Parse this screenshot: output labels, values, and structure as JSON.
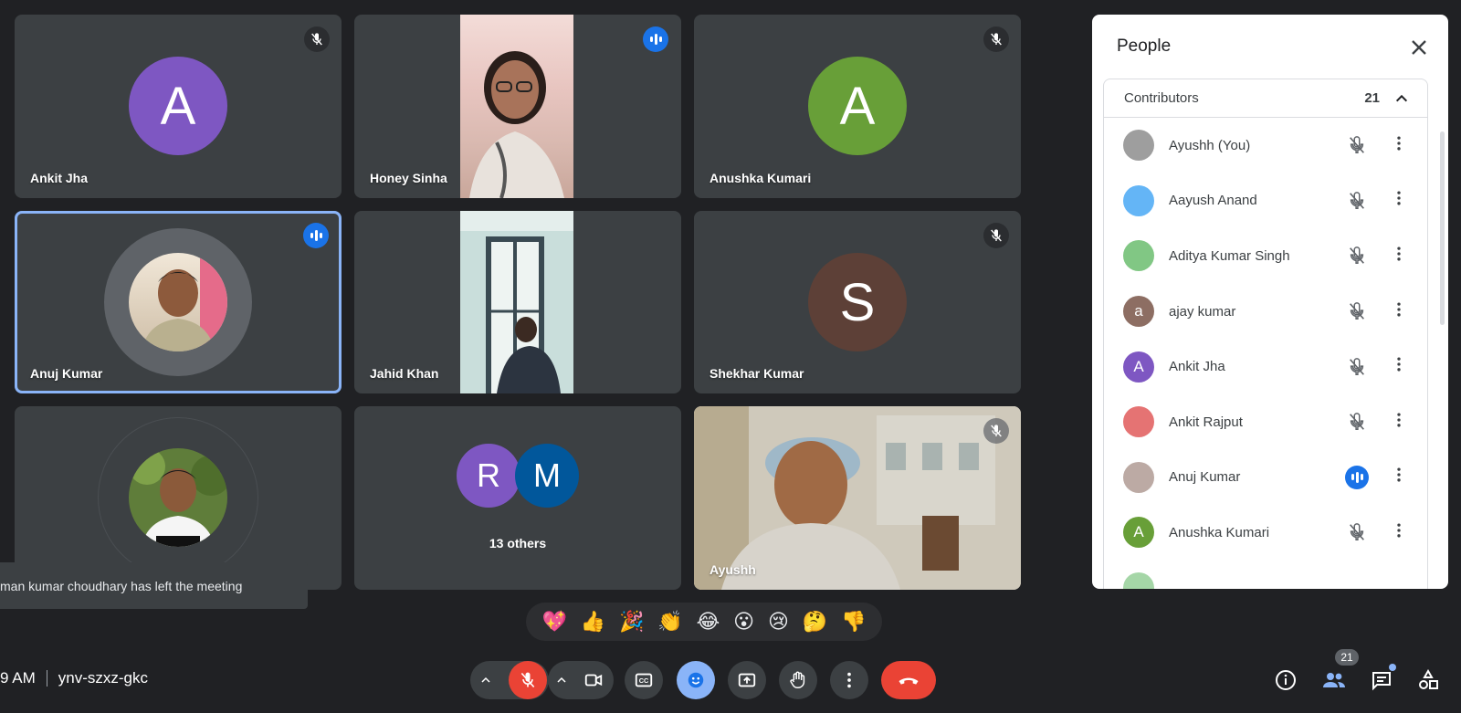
{
  "tiles": {
    "ankit": {
      "name": "Ankit Jha",
      "initial": "A",
      "color": "#7e57c2"
    },
    "honey": {
      "name": "Honey Sinha"
    },
    "anushka": {
      "name": "Anushka Kumari",
      "initial": "A",
      "color": "#689f38"
    },
    "anuj": {
      "name": "Anuj Kumar"
    },
    "jahid": {
      "name": "Jahid Khan"
    },
    "shekhar": {
      "name": "Shekhar Kumar",
      "initial": "S",
      "color": "#5d4037"
    },
    "others": {
      "initial_1": "R",
      "initial_2": "M",
      "label": "13 others"
    },
    "ayushh": {
      "name": "Ayushh"
    }
  },
  "toast": {
    "text": "man kumar choudhary has left the meeting"
  },
  "reactions": [
    "💖",
    "👍",
    "🎉",
    "👏",
    "😂",
    "😮",
    "😢",
    "🤔",
    "👎"
  ],
  "meeting": {
    "time": "9 AM",
    "code": "ynv-szxz-gkc"
  },
  "people_panel": {
    "title": "People",
    "section": "Contributors",
    "count": "21",
    "participants": [
      {
        "name": "Ayushh (You)",
        "initial": "",
        "color": "#9e9e9e",
        "status": "muted"
      },
      {
        "name": "Aayush Anand",
        "initial": "",
        "color": "#64b5f6",
        "status": "muted"
      },
      {
        "name": "Aditya Kumar Singh",
        "initial": "",
        "color": "#81c784",
        "status": "muted"
      },
      {
        "name": "ajay kumar",
        "initial": "a",
        "color": "#8d6e63",
        "status": "muted"
      },
      {
        "name": "Ankit Jha",
        "initial": "A",
        "color": "#7e57c2",
        "status": "muted"
      },
      {
        "name": "Ankit Rajput",
        "initial": "",
        "color": "#e57373",
        "status": "muted"
      },
      {
        "name": "Anuj Kumar",
        "initial": "",
        "color": "#bcaaa4",
        "status": "speaking"
      },
      {
        "name": "Anushka Kumari",
        "initial": "A",
        "color": "#689f38",
        "status": "muted"
      }
    ]
  },
  "toolbar": {
    "participants_badge": "21"
  }
}
